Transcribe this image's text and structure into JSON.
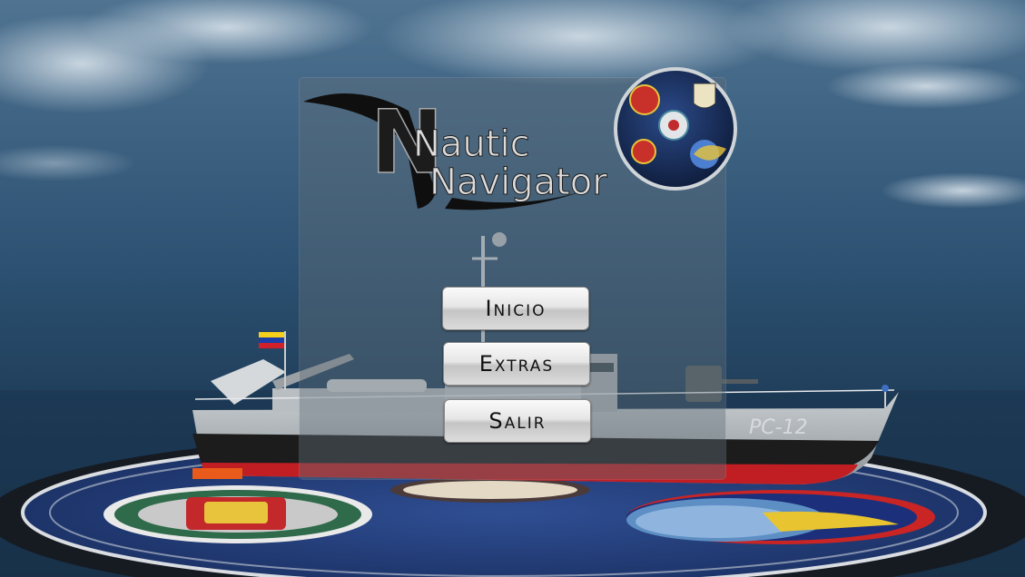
{
  "game": {
    "title_line1": "Nautic",
    "title_line2": "Navigator",
    "logo_n": "N"
  },
  "menu": {
    "items": [
      {
        "id": "inicio",
        "label": "Inicio"
      },
      {
        "id": "extras",
        "label": "Extras"
      },
      {
        "id": "salir",
        "label": "Salir"
      }
    ]
  },
  "ship": {
    "hull_number": "PC-12"
  },
  "colors": {
    "sky": "#2b4d6b",
    "sea": "#1e3a52",
    "hull_grey": "#9aa1a6",
    "hull_black": "#1a1a1a",
    "hull_red": "#c11e24",
    "platform_blue": "#2a4a8c",
    "button_bg": "#e6e6e6"
  }
}
